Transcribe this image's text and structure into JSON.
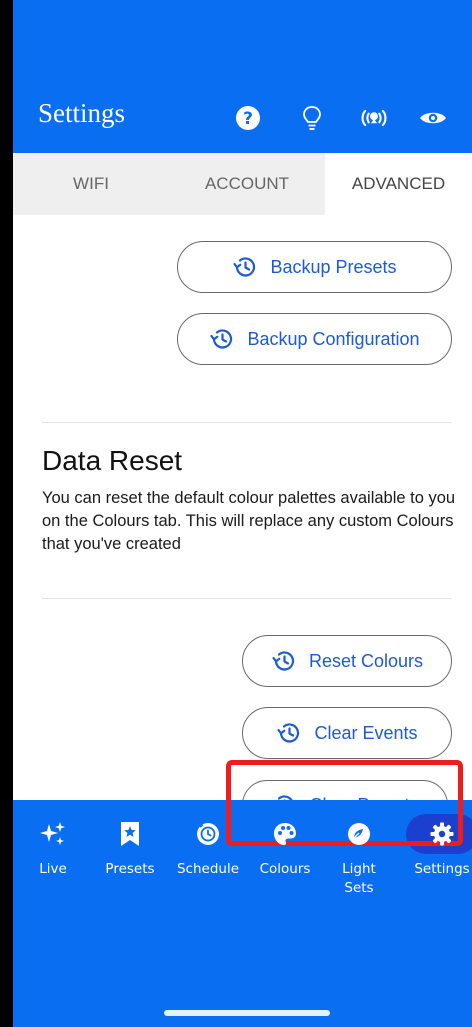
{
  "header": {
    "title": "Settings",
    "icons": [
      "help-icon",
      "bulb-icon",
      "broadcast-icon",
      "eye-icon"
    ]
  },
  "tabs": [
    {
      "label": "WIFI",
      "active": false
    },
    {
      "label": "ACCOUNT",
      "active": false
    },
    {
      "label": "ADVANCED",
      "active": true
    }
  ],
  "backup": {
    "presets_label": "Backup Presets",
    "configuration_label": "Backup Configuration"
  },
  "data_reset": {
    "title": "Data Reset",
    "description": "You can reset the default colour palettes available to you on the Colours tab. This will replace any custom Colours that you've created",
    "reset_colours_label": "Reset Colours",
    "clear_events_label": "Clear Events",
    "clear_presets_label": "Clear Presets"
  },
  "bottom_nav": [
    {
      "label": "Live",
      "icon": "sparkles-icon",
      "active": false
    },
    {
      "label": "Presets",
      "icon": "bookmark-star-icon",
      "active": false
    },
    {
      "label": "Schedule",
      "icon": "clock-icon",
      "active": false
    },
    {
      "label": "Colours",
      "icon": "palette-icon",
      "active": false
    },
    {
      "label": "Light Sets",
      "icon": "light-sets-icon",
      "active": false
    },
    {
      "label": "Settings",
      "icon": "gear-icon",
      "active": true
    }
  ],
  "colors": {
    "brand_blue": "#0a6ef3",
    "link_blue": "#1c5ad6",
    "highlight_red": "#f21b1b",
    "active_nav_bg": "#1b3fce"
  }
}
